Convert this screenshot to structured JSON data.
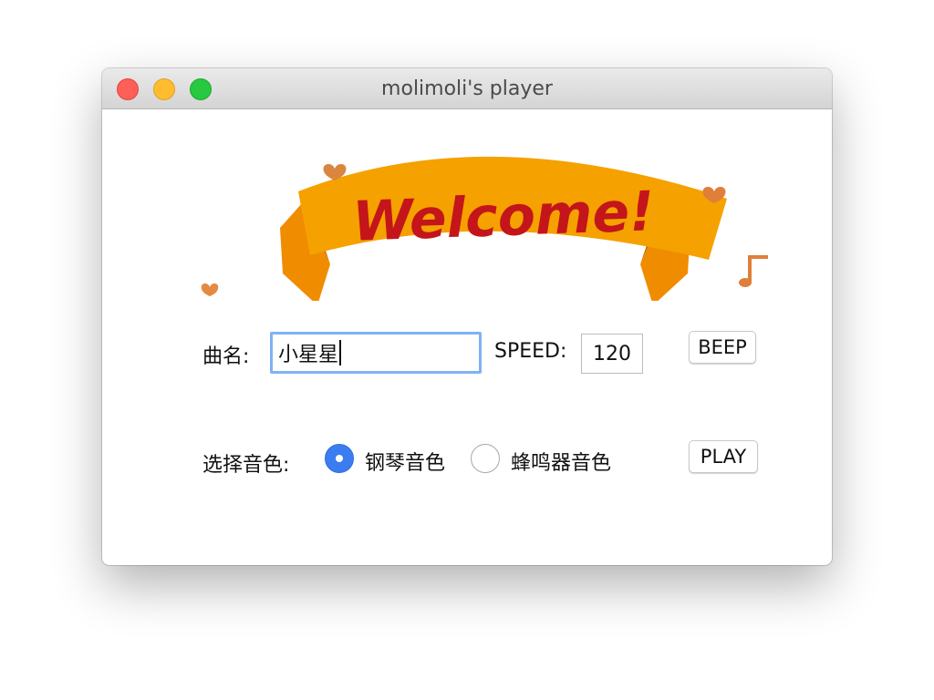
{
  "window": {
    "title": "molimoli's player"
  },
  "banner": {
    "text": "Welcome!",
    "ribbon_color": "#f5a100",
    "text_color": "#c4151b"
  },
  "form": {
    "song_label": "曲名:",
    "song_value": "小星星",
    "speed_label": "SPEED:",
    "speed_value": "120",
    "beep_label": "BEEP",
    "timbre_label": "选择音色:",
    "timbre_options": [
      {
        "label": "钢琴音色",
        "selected": true
      },
      {
        "label": "蜂鸣器音色",
        "selected": false
      }
    ],
    "play_label": "PLAY"
  },
  "colors": {
    "accent": "#3b7cf1",
    "focus_ring": "#7fb2f6"
  }
}
